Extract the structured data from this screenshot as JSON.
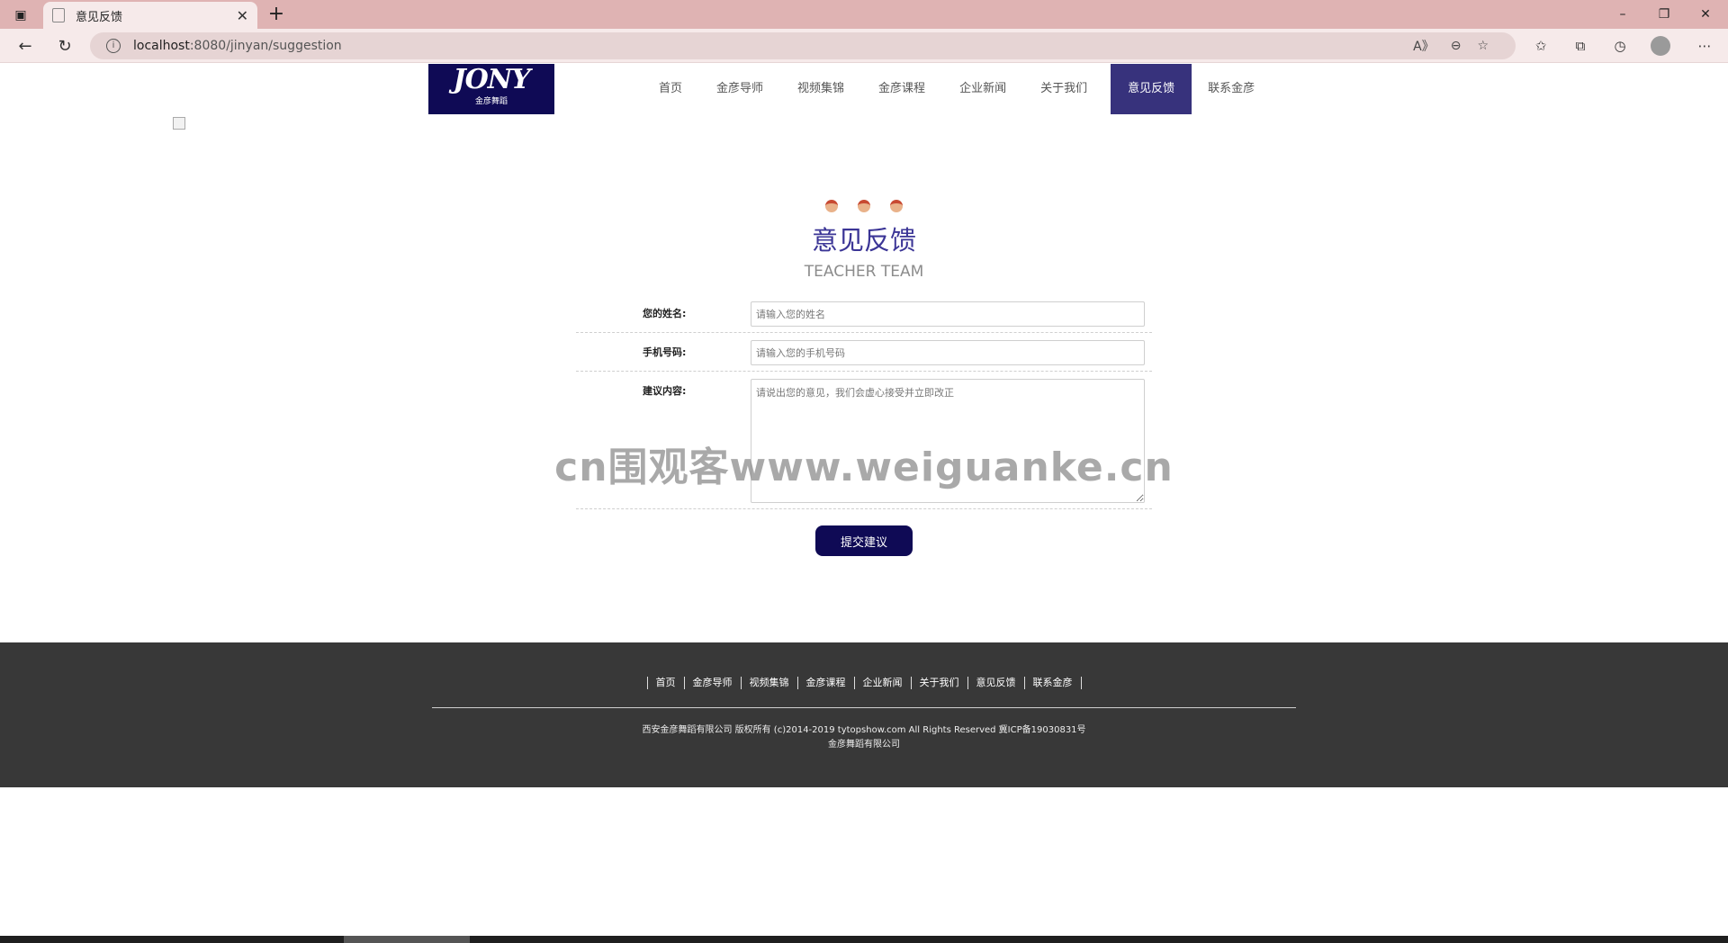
{
  "browser": {
    "tab_title": "意见反馈",
    "url_host": "localhost",
    "url_rest": ":8080/jinyan/suggestion",
    "window_controls": {
      "minimize": "–",
      "restore": "❐",
      "close": "✕"
    }
  },
  "site": {
    "logo_mark": "JONY",
    "logo_sub": "金彦舞蹈",
    "nav": [
      {
        "label": "首页"
      },
      {
        "label": "金彦导师"
      },
      {
        "label": "视频集锦"
      },
      {
        "label": "金彦课程"
      },
      {
        "label": "企业新闻"
      },
      {
        "label": "关于我们"
      },
      {
        "label": "意见反馈",
        "active": true
      },
      {
        "label": "联系金彦"
      }
    ]
  },
  "section": {
    "title": "意见反馈",
    "subtitle": "TEACHER TEAM"
  },
  "form": {
    "name_label": "您的姓名:",
    "name_placeholder": "请输入您的姓名",
    "phone_label": "手机号码:",
    "phone_placeholder": "请输入您的手机号码",
    "content_label": "建议内容:",
    "content_placeholder": "请说出您的意见，我们会虚心接受并立即改正",
    "submit_label": "提交建议"
  },
  "watermark": "cn围观客www.weiguanke.cn",
  "footer": {
    "nav": [
      "首页",
      "金彦导师",
      "视频集锦",
      "金彦课程",
      "企业新闻",
      "关于我们",
      "意见反馈",
      "联系金彦"
    ],
    "copyright": "西安金彦舞蹈有限公司 版权所有 (c)2014-2019 tytopshow.com All Rights Reserved 冀ICP备19030831号",
    "company": "金彦舞蹈有限公司"
  },
  "colors": {
    "tabbar": "#dfb3b3",
    "brand_navy": "#0f0a55",
    "nav_active": "#37327c",
    "footer_bg": "#383838"
  }
}
